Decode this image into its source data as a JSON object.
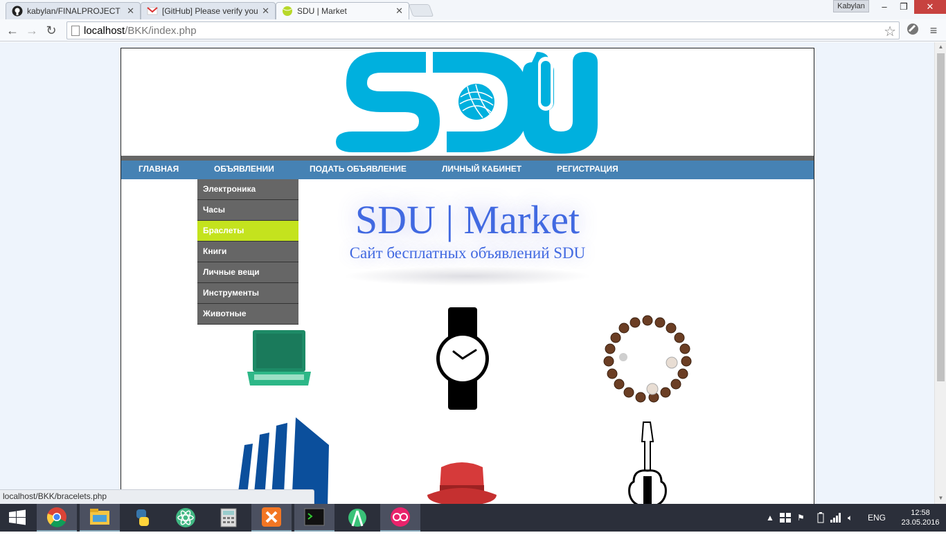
{
  "browser": {
    "tabs": [
      {
        "title": "kabylan/FINALPROJECT",
        "icon": "github-icon"
      },
      {
        "title": "[GitHub] Please verify you",
        "icon": "gmail-icon"
      },
      {
        "title": "SDU | Market",
        "icon": "tennis-ball-icon"
      }
    ],
    "user": "Kabylan",
    "url_host": "localhost",
    "url_path": "/BKK/index.php",
    "status_url": "localhost/BKK/bracelets.php"
  },
  "site": {
    "menu": [
      "ГЛАВНАЯ",
      "ОБЪЯВЛЕНИИ",
      "ПОДАТЬ ОБЪЯВЛЕНИЕ",
      "ЛИЧНЫЙ КАБИНЕТ",
      "РЕГИСТРАЦИЯ"
    ],
    "dropdown": [
      "Электроника",
      "Часы",
      "Браслеты",
      "Книги",
      "Личные вещи",
      "Инструменты",
      "Животные"
    ],
    "dropdown_active": "Браслеты",
    "hero_title": "SDU | Market",
    "hero_subtitle": "Сайт бесплатных объявлений SDU",
    "categories": [
      {
        "icon": "laptop-icon"
      },
      {
        "icon": "wristwatch-icon"
      },
      {
        "icon": "bracelet-image"
      },
      {
        "icon": "books-icon"
      },
      {
        "icon": "hat-icon"
      },
      {
        "icon": "guitar-icon"
      }
    ],
    "colors": {
      "logo": "#00b0de",
      "menu": "#4682b4",
      "active": "#c4e31e",
      "hero": "#4169e1"
    }
  },
  "taskbar": {
    "lang": "ENG",
    "time": "12:58",
    "date": "23.05.2016"
  }
}
